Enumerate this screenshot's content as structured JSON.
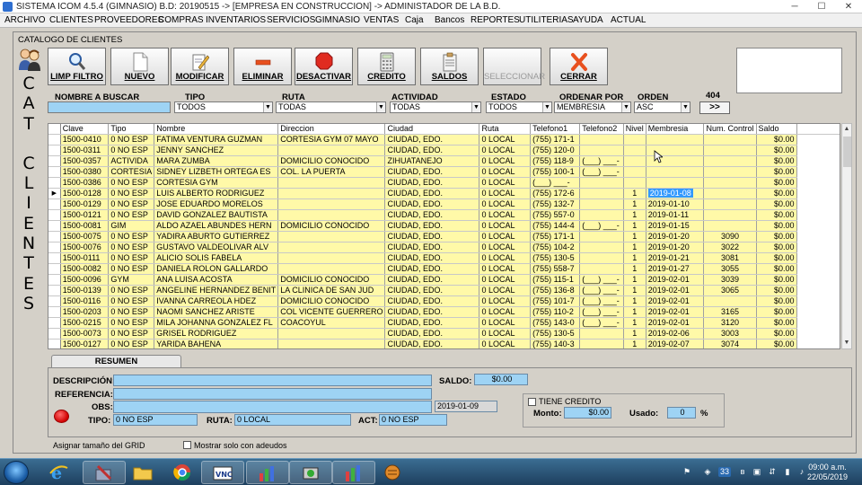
{
  "window": {
    "title": "SISTEMA ICOM 4.5.4 (GIMNASIO)  B.D: 20190515  ->  [EMPRESA EN CONSTRUCCION]  ->  ADMINISTADOR DE LA B.D.",
    "min": "─",
    "max": "☐",
    "close": "✕"
  },
  "menu": [
    "ARCHIVO",
    "CLIENTES",
    "PROVEEDORES",
    "COMPRAS",
    "INVENTARIOS",
    "SERVICIOS",
    "GIMNASIO",
    "VENTAS",
    "Caja",
    "Bancos",
    "REPORTES",
    "UTILITERIAS",
    "AYUDA",
    "ACTUAL"
  ],
  "form": {
    "title": "CATALOGO DE CLIENTES",
    "side_text": [
      "C",
      "A",
      "T",
      "",
      "C",
      "L",
      "I",
      "E",
      "N",
      "T",
      "E",
      "S"
    ]
  },
  "toolbar": [
    {
      "label": "LIMP FILTRO",
      "icon": "magnifier-icon",
      "enabled": true
    },
    {
      "label": "NUEVO",
      "icon": "new-document-icon",
      "enabled": true
    },
    {
      "label": "MODIFICAR",
      "icon": "edit-pencil-icon",
      "enabled": true
    },
    {
      "label": "ELIMINAR",
      "icon": "minus-icon",
      "enabled": true
    },
    {
      "label": "DESACTIVAR",
      "icon": "stop-sign-icon",
      "enabled": true
    },
    {
      "label": "CREDITO",
      "icon": "calculator-icon",
      "enabled": true
    },
    {
      "label": "SALDOS",
      "icon": "clipboard-icon",
      "enabled": true
    },
    {
      "label": "SELECCIONAR",
      "icon": "select-icon",
      "enabled": false
    },
    {
      "label": "CERRAR",
      "icon": "close-x-icon",
      "enabled": true
    }
  ],
  "filters": {
    "nombre_label": "NOMBRE A BUSCAR",
    "nombre_value": "",
    "tipo_label": "TIPO",
    "tipo_value": "TODOS",
    "ruta_label": "RUTA",
    "ruta_value": "TODAS",
    "actividad_label": "ACTIVIDAD",
    "actividad_value": "TODAS",
    "estado_label": "ESTADO",
    "estado_value": "TODOS",
    "ordenar_label": "ORDENAR POR",
    "ordenar_value": "MEMBRESIA",
    "orden_label": "ORDEN",
    "orden_value": "ASC",
    "count": "404",
    "go_label": ">>"
  },
  "grid": {
    "columns": [
      "Clave",
      "Tipo",
      "Nombre",
      "Direccion",
      "Ciudad",
      "Ruta",
      "Telefono1",
      "Telefono2",
      "Nivel",
      "Membresia",
      "Num. Control",
      "Saldo"
    ],
    "rows": [
      [
        "1500-0410",
        "0 NO ESP",
        "FATIMA VENTURA GUZMAN",
        "CORTESIA GYM 07 MAYO",
        "CIUDAD, EDO.",
        "0 LOCAL",
        "(755) 171-1",
        "",
        "",
        "",
        "",
        "$0.00"
      ],
      [
        "1500-0311",
        "0 NO ESP",
        "JENNY SANCHEZ",
        "",
        "CIUDAD, EDO.",
        "0 LOCAL",
        "(755) 120-0",
        "",
        "",
        "",
        "",
        "$0.00"
      ],
      [
        "1500-0357",
        "ACTIVIDA",
        "MARA ZUMBA",
        "DOMICILIO CONOCIDO",
        "ZIHUATANEJO",
        "0 LOCAL",
        "(755) 118-9",
        "(___) ___-",
        "",
        "",
        "",
        "$0.00"
      ],
      [
        "1500-0380",
        "CORTESIA",
        "SIDNEY LIZBETH ORTEGA ES",
        "COL. LA PUERTA",
        "CIUDAD, EDO.",
        "0 LOCAL",
        "(755) 100-1",
        "(___) ___-",
        "",
        "",
        "",
        "$0.00"
      ],
      [
        "1500-0386",
        "0 NO ESP",
        "CORTESIA GYM",
        "",
        "CIUDAD, EDO.",
        "0 LOCAL",
        "(___) ___-",
        "",
        "",
        "",
        "",
        "$0.00"
      ],
      [
        "1500-0128",
        "0 NO ESP",
        "LUIS ALBERTO RODRIGUEZ",
        "",
        "CIUDAD, EDO.",
        "0 LOCAL",
        "(755) 172-6",
        "",
        "1",
        "2019-01-08",
        "",
        "$0.00"
      ],
      [
        "1500-0129",
        "0 NO ESP",
        "JOSE EDUARDO MORELOS",
        "",
        "CIUDAD, EDO.",
        "0 LOCAL",
        "(755) 132-7",
        "",
        "1",
        "2019-01-10",
        "",
        "$0.00"
      ],
      [
        "1500-0121",
        "0 NO ESP",
        "DAVID GONZALEZ BAUTISTA",
        "",
        "CIUDAD, EDO.",
        "0 LOCAL",
        "(755) 557-0",
        "",
        "1",
        "2019-01-11",
        "",
        "$0.00"
      ],
      [
        "1500-0081",
        "GIM",
        "ALDO AZAEL ABUNDES HERN",
        "DOMICILIO CONOCIDO",
        "CIUDAD, EDO.",
        "0 LOCAL",
        "(755) 144-4",
        "(___) ___-",
        "1",
        "2019-01-15",
        "",
        "$0.00"
      ],
      [
        "1500-0075",
        "0 NO ESP",
        "YADIRA ABURTO GUTIERREZ",
        "",
        "CIUDAD, EDO.",
        "0 LOCAL",
        "(755) 171-1",
        "",
        "1",
        "2019-01-20",
        "3090",
        "$0.00"
      ],
      [
        "1500-0076",
        "0 NO ESP",
        "GUSTAVO VALDEOLIVAR ALV",
        "",
        "CIUDAD, EDO.",
        "0 LOCAL",
        "(755) 104-2",
        "",
        "1",
        "2019-01-20",
        "3022",
        "$0.00"
      ],
      [
        "1500-0111",
        "0 NO ESP",
        "ALICIO SOLIS FABELA",
        "",
        "CIUDAD, EDO.",
        "0 LOCAL",
        "(755) 130-5",
        "",
        "1",
        "2019-01-21",
        "3081",
        "$0.00"
      ],
      [
        "1500-0082",
        "0 NO ESP",
        "DANIELA ROLON GALLARDO",
        "",
        "CIUDAD, EDO.",
        "0 LOCAL",
        "(755) 558-7",
        "",
        "1",
        "2019-01-27",
        "3055",
        "$0.00"
      ],
      [
        "1500-0096",
        "GYM",
        "ANA LUISA ACOSTA",
        "DOMICILIO CONOCIDO",
        "CIUDAD, EDO.",
        "0 LOCAL",
        "(755) 115-1",
        "(___) ___-",
        "1",
        "2019-02-01",
        "3039",
        "$0.00"
      ],
      [
        "1500-0139",
        "0 NO ESP",
        "ANGELINE HERNANDEZ BENIT",
        "LA CLINICA DE SAN JUD",
        "CIUDAD, EDO.",
        "0 LOCAL",
        "(755) 136-8",
        "(___) ___-",
        "1",
        "2019-02-01",
        "3065",
        "$0.00"
      ],
      [
        "1500-0116",
        "0 NO ESP",
        "IVANNA CARREOLA HDEZ",
        "DOMICILIO CONOCIDO",
        "CIUDAD, EDO.",
        "0 LOCAL",
        "(755) 101-7",
        "(___) ___-",
        "1",
        "2019-02-01",
        "",
        "$0.00"
      ],
      [
        "1500-0203",
        "0 NO ESP",
        "NAOMI SANCHEZ ARISTE",
        "COL VICENTE GUERRERO",
        "CIUDAD, EDO.",
        "0 LOCAL",
        "(755) 110-2",
        "(___) ___-",
        "1",
        "2019-02-01",
        "3165",
        "$0.00"
      ],
      [
        "1500-0215",
        "0 NO ESP",
        "MILA JOHANNA GONZALEZ FL",
        "COACOYUL",
        "CIUDAD, EDO.",
        "0 LOCAL",
        "(755) 143-0",
        "(___) ___-",
        "1",
        "2019-02-01",
        "3120",
        "$0.00"
      ],
      [
        "1500-0073",
        "0 NO ESP",
        "GRISEL RODRIGUEZ",
        "",
        "CIUDAD, EDO.",
        "0 LOCAL",
        "(755) 130-5",
        "",
        "1",
        "2019-02-06",
        "3003",
        "$0.00"
      ],
      [
        "1500-0127",
        "0 NO ESP",
        "YARIDA BAHENA",
        "",
        "CIUDAD, EDO.",
        "0 LOCAL",
        "(755) 140-3",
        "",
        "1",
        "2019-02-07",
        "3074",
        "$0.00"
      ]
    ],
    "current_row": 5,
    "selected_cell_row": 5,
    "selected_cell_col": 9
  },
  "resumen": {
    "tab_label": "RESUMEN",
    "descripcion_label": "DESCRIPCIÓN:",
    "descripcion_value": "",
    "referencia_label": "REFERENCIA:",
    "referencia_value": "",
    "obs_label": "OBS:",
    "obs_value": "",
    "date_value": "2019-01-09",
    "tipo_label": "TIPO:",
    "tipo_value": "0 NO ESP",
    "ruta_label": "RUTA:",
    "ruta_value": "0 LOCAL",
    "act_label": "ACT:",
    "act_value": "0 NO ESP",
    "saldo_label": "SALDO:",
    "saldo_value": "$0.00",
    "tiene_credito_label": "TIENE CREDITO",
    "monto_label": "Monto:",
    "monto_value": "$0.00",
    "usado_label": "Usado:",
    "usado_value": "0",
    "percent": "%"
  },
  "footer": {
    "grid_size_label": "Asignar tamaño del GRID",
    "solo_adeudos_label": "Mostrar solo con adeudos"
  },
  "taskbar": {
    "apps": [
      "internet-explorer-icon",
      "tools-icon",
      "folder-icon",
      "chrome-icon",
      "vnc-icon",
      "chart-app-icon",
      "network-app-icon",
      "chart-app-icon-2",
      "glove-app-icon"
    ],
    "tray_number": "33",
    "time": "09:00 a.m.",
    "date": "22/05/2019"
  }
}
